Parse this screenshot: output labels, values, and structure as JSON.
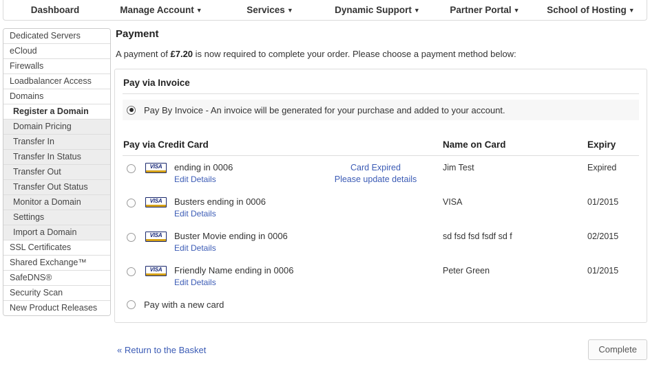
{
  "topnav": {
    "items": [
      {
        "label": "Dashboard",
        "caret": false
      },
      {
        "label": "Manage Account",
        "caret": true
      },
      {
        "label": "Services",
        "caret": true
      },
      {
        "label": "Dynamic Support",
        "caret": true
      },
      {
        "label": "Partner Portal",
        "caret": true
      },
      {
        "label": "School of Hosting",
        "caret": true
      }
    ],
    "caret_glyph": "▼"
  },
  "sidebar": {
    "items": [
      {
        "label": "Dedicated Servers",
        "type": "top"
      },
      {
        "label": "eCloud",
        "type": "top"
      },
      {
        "label": "Firewalls",
        "type": "top"
      },
      {
        "label": "Loadbalancer Access",
        "type": "top"
      },
      {
        "label": "Domains",
        "type": "top"
      },
      {
        "label": "Register a Domain",
        "type": "active"
      },
      {
        "label": "Domain Pricing",
        "type": "sub"
      },
      {
        "label": "Transfer In",
        "type": "sub"
      },
      {
        "label": "Transfer In Status",
        "type": "sub"
      },
      {
        "label": "Transfer Out",
        "type": "sub"
      },
      {
        "label": "Transfer Out Status",
        "type": "sub"
      },
      {
        "label": "Monitor a Domain",
        "type": "sub"
      },
      {
        "label": "Settings",
        "type": "sub"
      },
      {
        "label": "Import a Domain",
        "type": "sub"
      },
      {
        "label": "SSL Certificates",
        "type": "top"
      },
      {
        "label": "Shared Exchange™",
        "type": "top"
      },
      {
        "label": "SafeDNS®",
        "type": "top"
      },
      {
        "label": "Security Scan",
        "type": "top"
      },
      {
        "label": "New Product Releases",
        "type": "top"
      }
    ]
  },
  "page": {
    "title": "Payment",
    "lede_prefix": "A payment of ",
    "amount": "£7.20",
    "lede_suffix": " is now required to complete your order. Please choose a payment method below:"
  },
  "invoice": {
    "heading": "Pay via Invoice",
    "option_label": "Pay By Invoice - An invoice will be generated for your purchase and added to your account.",
    "selected": true
  },
  "credit_card": {
    "heading": "Pay via Credit Card",
    "col_name": "Name on Card",
    "col_expiry": "Expiry",
    "edit_label": "Edit Details",
    "new_card_label": "Pay with a new card",
    "cards": [
      {
        "brand": "VISA",
        "label": "ending in 0006",
        "edit": "Edit Details",
        "status_line1": "Card Expired",
        "status_line2": "Please update details",
        "holder": "Jim Test",
        "expiry": "Expired",
        "selected": false
      },
      {
        "brand": "VISA",
        "label": "Busters ending in 0006",
        "edit": "Edit Details",
        "status_line1": "",
        "status_line2": "",
        "holder": "VISA",
        "expiry": "01/2015",
        "selected": false
      },
      {
        "brand": "VISA",
        "label": "Buster Movie ending in 0006",
        "edit": "Edit Details",
        "status_line1": "",
        "status_line2": "",
        "holder": "sd fsd fsd fsdf sd f",
        "expiry": "02/2015",
        "selected": false
      },
      {
        "brand": "VISA",
        "label": "Friendly Name ending in 0006",
        "edit": "Edit Details",
        "status_line1": "",
        "status_line2": "",
        "holder": "Peter Green",
        "expiry": "01/2015",
        "selected": false
      }
    ]
  },
  "footer": {
    "return_link": "« Return to the Basket",
    "complete_button": "Complete"
  },
  "colors": {
    "link": "#3b5bb5",
    "visa_blue": "#1a2a7a",
    "visa_gold": "#d4a017",
    "row_bg": "#f7f7f7"
  }
}
